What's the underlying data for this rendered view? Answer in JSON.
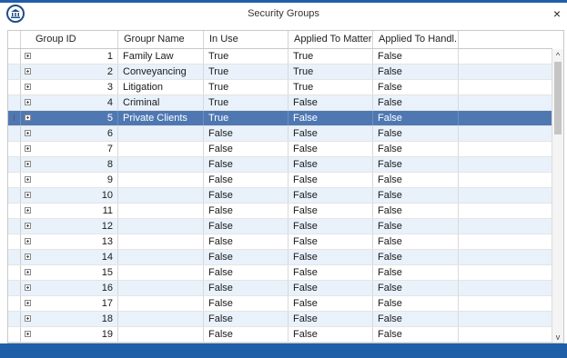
{
  "window": {
    "title": "Security Groups",
    "close_label": "×"
  },
  "columns": [
    "Group ID",
    "Groupr Name",
    "In Use",
    "Applied To Matter",
    "Applied To Handl..."
  ],
  "selected_row_index": 4,
  "row_indicator": "I",
  "rows": [
    {
      "id": "1",
      "name": "Family Law",
      "in_use": "True",
      "matter": "True",
      "handler": "False"
    },
    {
      "id": "2",
      "name": "Conveyancing",
      "in_use": "True",
      "matter": "True",
      "handler": "False"
    },
    {
      "id": "3",
      "name": "Litigation",
      "in_use": "True",
      "matter": "True",
      "handler": "False"
    },
    {
      "id": "4",
      "name": "Criminal",
      "in_use": "True",
      "matter": "False",
      "handler": "False"
    },
    {
      "id": "5",
      "name": "Private Clients",
      "in_use": "True",
      "matter": "False",
      "handler": "False"
    },
    {
      "id": "6",
      "name": "",
      "in_use": "False",
      "matter": "False",
      "handler": "False"
    },
    {
      "id": "7",
      "name": "",
      "in_use": "False",
      "matter": "False",
      "handler": "False"
    },
    {
      "id": "8",
      "name": "",
      "in_use": "False",
      "matter": "False",
      "handler": "False"
    },
    {
      "id": "9",
      "name": "",
      "in_use": "False",
      "matter": "False",
      "handler": "False"
    },
    {
      "id": "10",
      "name": "",
      "in_use": "False",
      "matter": "False",
      "handler": "False"
    },
    {
      "id": "11",
      "name": "",
      "in_use": "False",
      "matter": "False",
      "handler": "False"
    },
    {
      "id": "12",
      "name": "",
      "in_use": "False",
      "matter": "False",
      "handler": "False"
    },
    {
      "id": "13",
      "name": "",
      "in_use": "False",
      "matter": "False",
      "handler": "False"
    },
    {
      "id": "14",
      "name": "",
      "in_use": "False",
      "matter": "False",
      "handler": "False"
    },
    {
      "id": "15",
      "name": "",
      "in_use": "False",
      "matter": "False",
      "handler": "False"
    },
    {
      "id": "16",
      "name": "",
      "in_use": "False",
      "matter": "False",
      "handler": "False"
    },
    {
      "id": "17",
      "name": "",
      "in_use": "False",
      "matter": "False",
      "handler": "False"
    },
    {
      "id": "18",
      "name": "",
      "in_use": "False",
      "matter": "False",
      "handler": "False"
    },
    {
      "id": "19",
      "name": "",
      "in_use": "False",
      "matter": "False",
      "handler": "False"
    }
  ],
  "scrollbar": {
    "up_glyph": "^",
    "down_glyph": "v"
  },
  "colors": {
    "accent": "#1f5fa8",
    "selected_row": "#4f78b3",
    "alt_row": "#e9f2fb"
  }
}
